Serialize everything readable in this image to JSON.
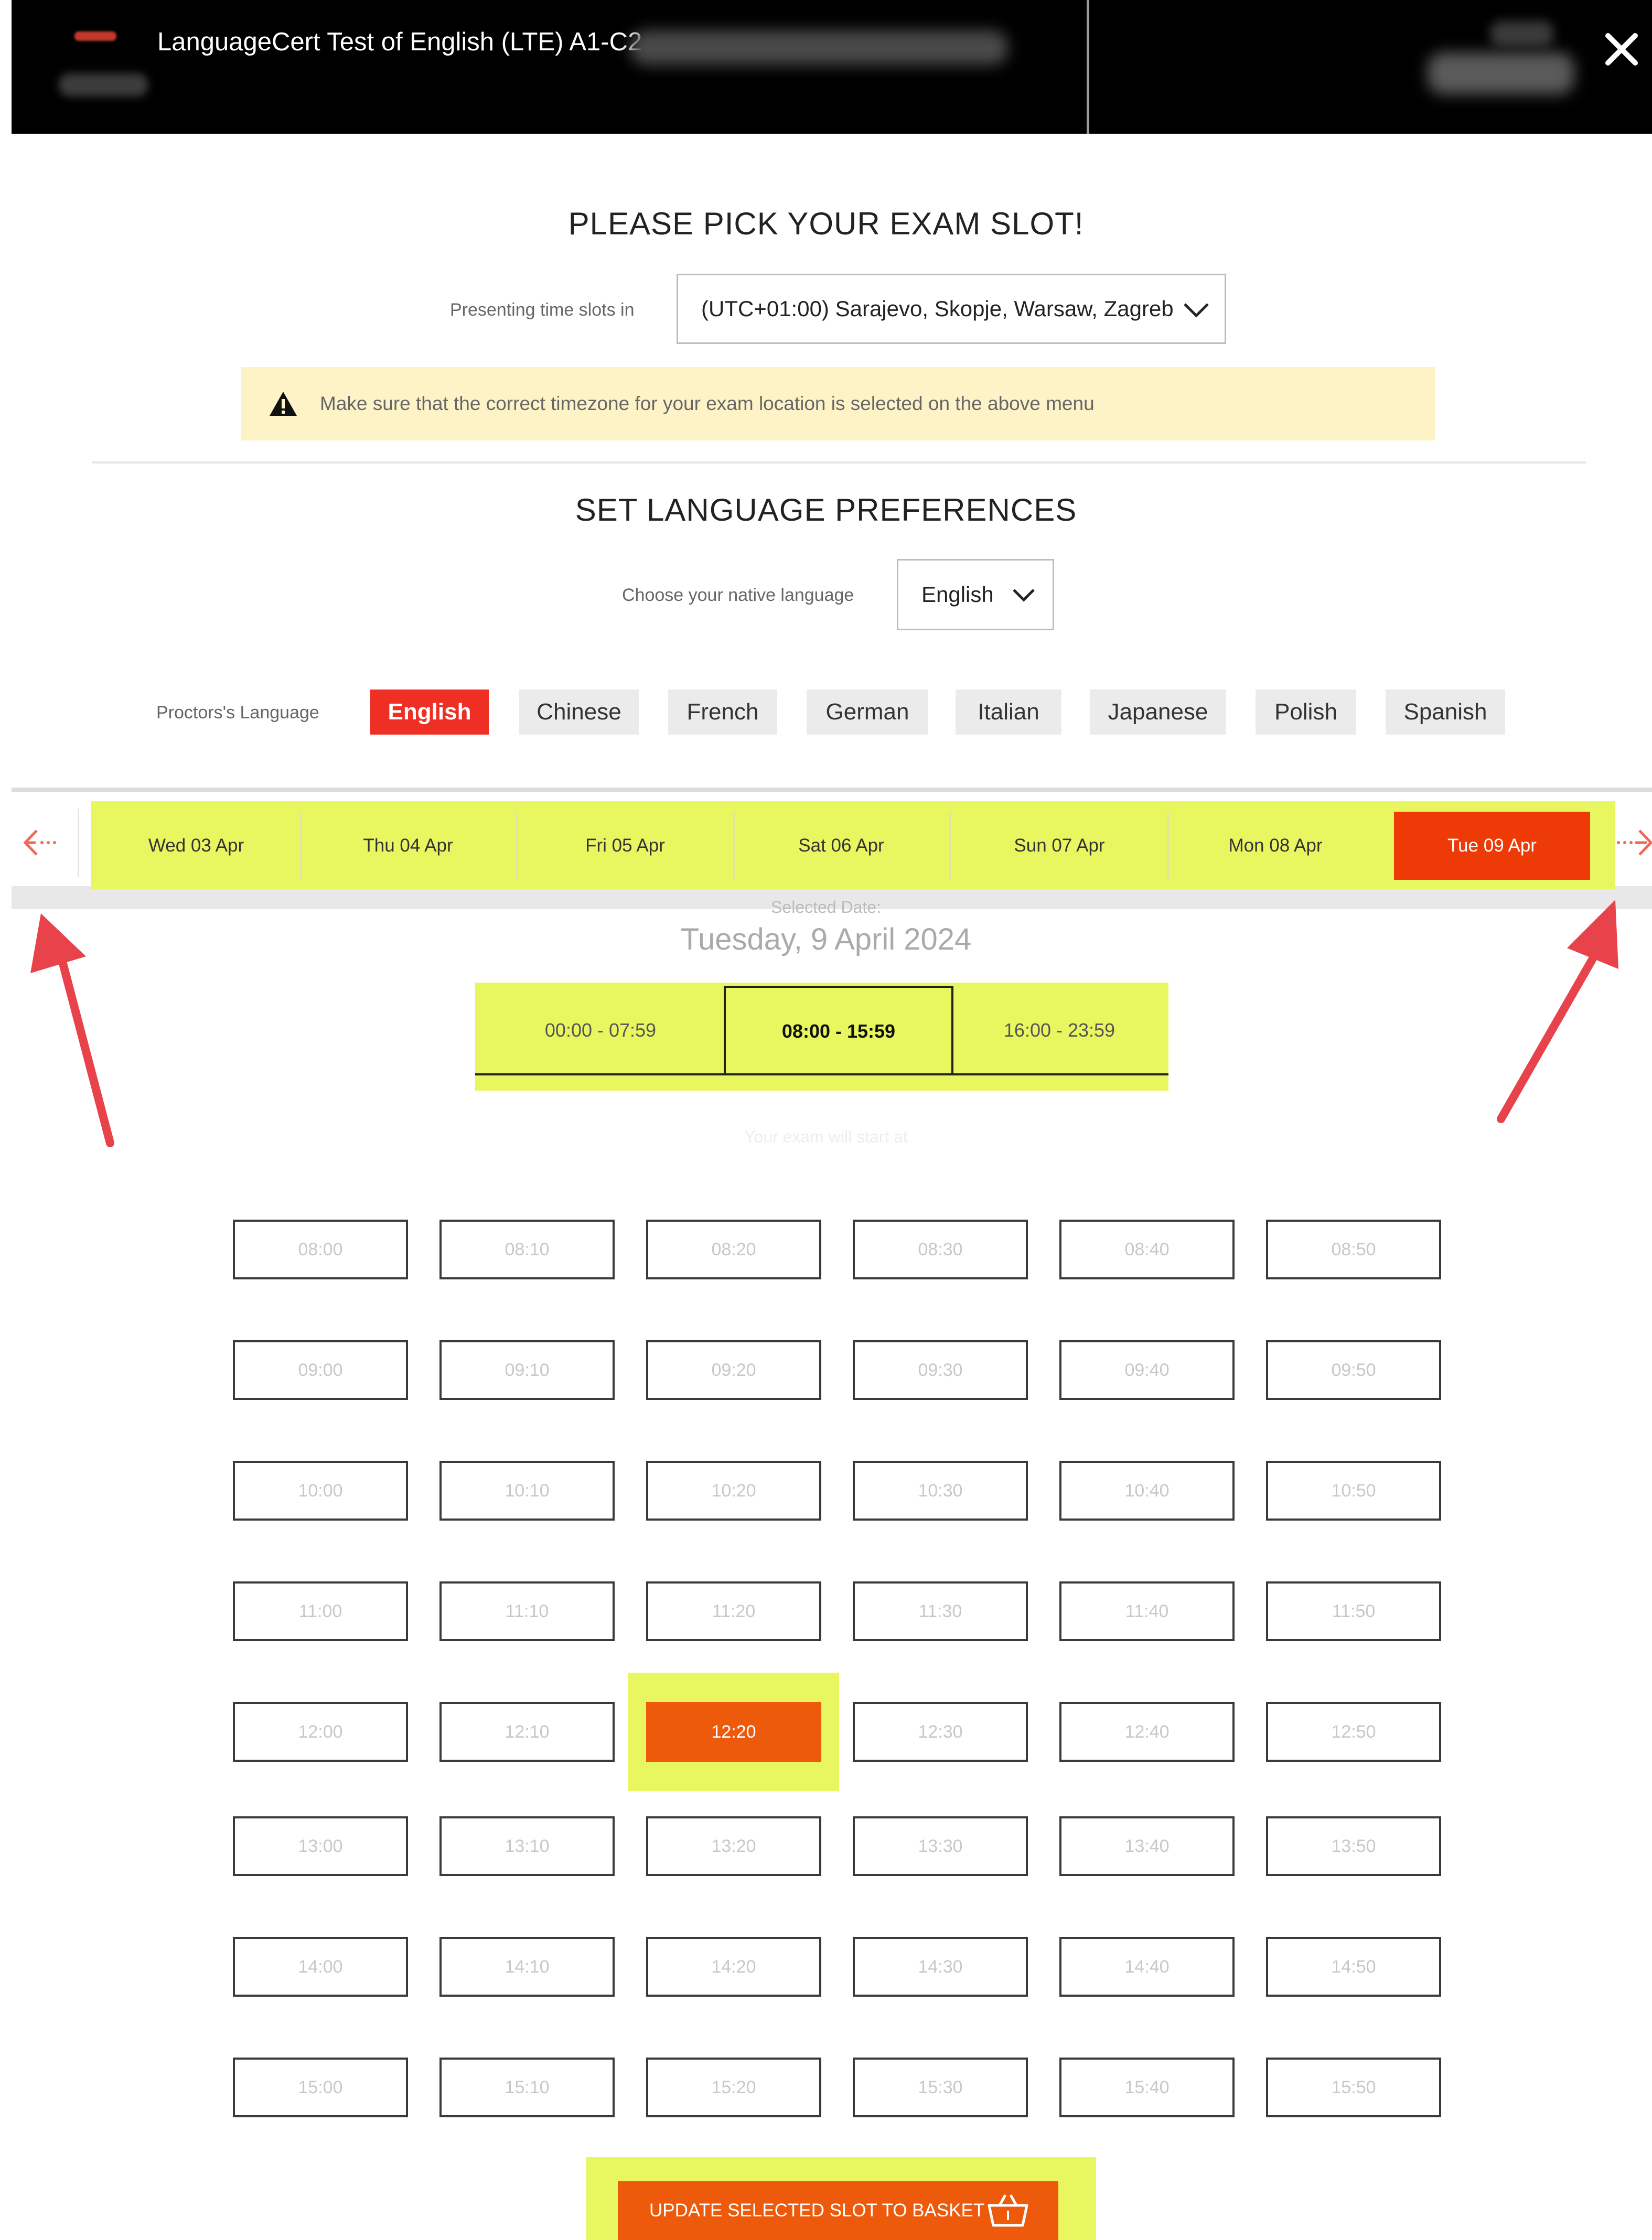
{
  "header": {
    "title": "LanguageCert Test of English (LTE) A1-C2",
    "close_icon": "close-icon"
  },
  "exam_slot": {
    "heading": "PLEASE PICK YOUR EXAM SLOT!",
    "timezone_label": "Presenting time slots in",
    "timezone_value": "(UTC+01:00) Sarajevo, Skopje, Warsaw, Zagreb",
    "warning": "Make sure that the correct timezone for your exam location is selected on the above menu"
  },
  "language_prefs": {
    "heading": "SET LANGUAGE PREFERENCES",
    "native_label": "Choose your native language",
    "native_value": "English",
    "proctor_label": "Proctors's Language",
    "proctor_languages": [
      "English",
      "Chinese",
      "French",
      "German",
      "Italian",
      "Japanese",
      "Polish",
      "Spanish"
    ],
    "proctor_selected": "English"
  },
  "dates": {
    "items": [
      "Wed 03 Apr",
      "Thu 04 Apr",
      "Fri 05 Apr",
      "Sat 06 Apr",
      "Sun 07 Apr",
      "Mon 08 Apr",
      "Tue 09 Apr"
    ],
    "selected": "Tue 09 Apr",
    "selected_label": "Selected Date:",
    "selected_full": "Tuesday, 9 April 2024"
  },
  "time_ranges": {
    "items": [
      "00:00 - 07:59",
      "08:00 - 15:59",
      "16:00 - 23:59"
    ],
    "selected": "08:00 - 15:59",
    "note": "Your exam will start at"
  },
  "slots": {
    "rows": [
      [
        "08:00",
        "08:10",
        "08:20",
        "08:30",
        "08:40",
        "08:50"
      ],
      [
        "09:00",
        "09:10",
        "09:20",
        "09:30",
        "09:40",
        "09:50"
      ],
      [
        "10:00",
        "10:10",
        "10:20",
        "10:30",
        "10:40",
        "10:50"
      ],
      [
        "11:00",
        "11:10",
        "11:20",
        "11:30",
        "11:40",
        "11:50"
      ],
      [
        "12:00",
        "12:10",
        "12:20",
        "12:30",
        "12:40",
        "12:50"
      ],
      [
        "13:00",
        "13:10",
        "13:20",
        "13:30",
        "13:40",
        "13:50"
      ],
      [
        "14:00",
        "14:10",
        "14:20",
        "14:30",
        "14:40",
        "14:50"
      ],
      [
        "15:00",
        "15:10",
        "15:20",
        "15:30",
        "15:40",
        "15:50"
      ]
    ],
    "selected": "12:20"
  },
  "actions": {
    "basket_label": "UPDATE SELECTED SLOT TO BASKET",
    "basket_icon": "basket-icon"
  },
  "colors": {
    "accent": "#ee5a0c",
    "active_red": "#ef2f24",
    "highlight": "#e8f65f",
    "warning_bg": "#fdf3c7",
    "annotation_arrow": "#e8424a"
  }
}
